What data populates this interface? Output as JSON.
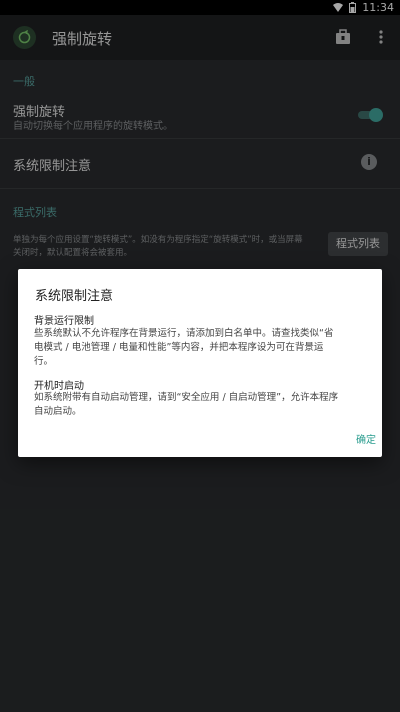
{
  "status_bar": {
    "time": "11:34"
  },
  "app_bar": {
    "title": "强制旋转"
  },
  "sections": {
    "general": "一般",
    "program_list": "程式列表"
  },
  "prefs": {
    "force_rotate": {
      "title": "强制旋转",
      "summary": "自动切换每个应用程序的旋转模式。",
      "enabled": true
    },
    "system_limit": {
      "title": "系统限制注意"
    },
    "program_list": {
      "summary_line1": "单独为每个应用设置“旋转模式”。如没有为程序指定“旋转模式”时，或当屏幕",
      "summary_line2": "关闭时，默认配置将会被套用。",
      "button": "程式列表"
    }
  },
  "dialog": {
    "title": "系统限制注意",
    "bg_heading": "背景运行限制",
    "bg_line1": "些系统默认不允许程序在背景运行，请添加到白名单中。请查找类似“省",
    "bg_line2": "电模式 / 电池管理 / 电量和性能”等内容，并把本程序设为可在背景运",
    "bg_line3": "行。",
    "boot_heading": "开机时启动",
    "boot_line1": "如系统附带有自动启动管理，请到“安全应用 / 自启动管理”，允许本程序",
    "boot_line2": "自动启动。",
    "ok": "确定"
  },
  "colors": {
    "accent": "#43a69d",
    "background": "#2a2c2e",
    "appbar": "#1f2123"
  }
}
